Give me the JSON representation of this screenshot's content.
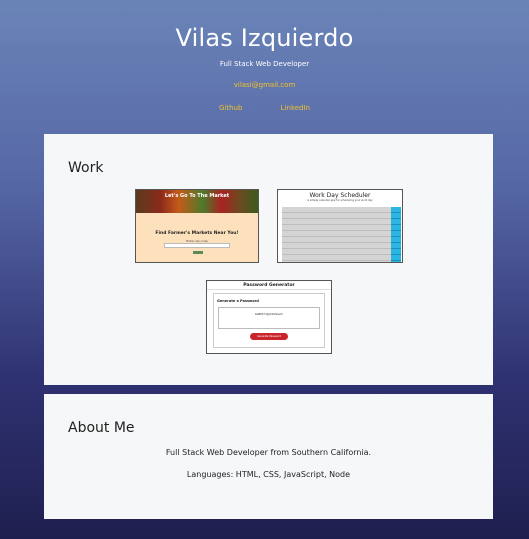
{
  "header": {
    "name": "Vilas Izquierdo",
    "role": "Full Stack Web Developer",
    "email": "vilasi@gmail.com",
    "links": [
      "Github",
      "LinkedIn"
    ]
  },
  "work": {
    "title": "Work",
    "projects": [
      {
        "banner_text": "Let's Go To The Market",
        "title": "Find Farmer's Markets Near You!",
        "sub": "Enter zip code"
      },
      {
        "title": "Work Day Scheduler",
        "sub": "A simple calendar app for scheduling your work day"
      },
      {
        "title": "Password Generator",
        "label": "Generate a Password",
        "output": "9wBE$7!@pK#zQ&2m",
        "button": "Generate Password"
      }
    ]
  },
  "about": {
    "title": "About Me",
    "line1": "Full Stack Web Developer from Southern California.",
    "line2": "Languages: HTML, CSS, JavaScript, Node"
  },
  "colors": {
    "accent": "#f3c12a",
    "card": "#f6f7f9",
    "scheduler_side": "#2bb5e3",
    "generate_btn": "#c9232b"
  }
}
